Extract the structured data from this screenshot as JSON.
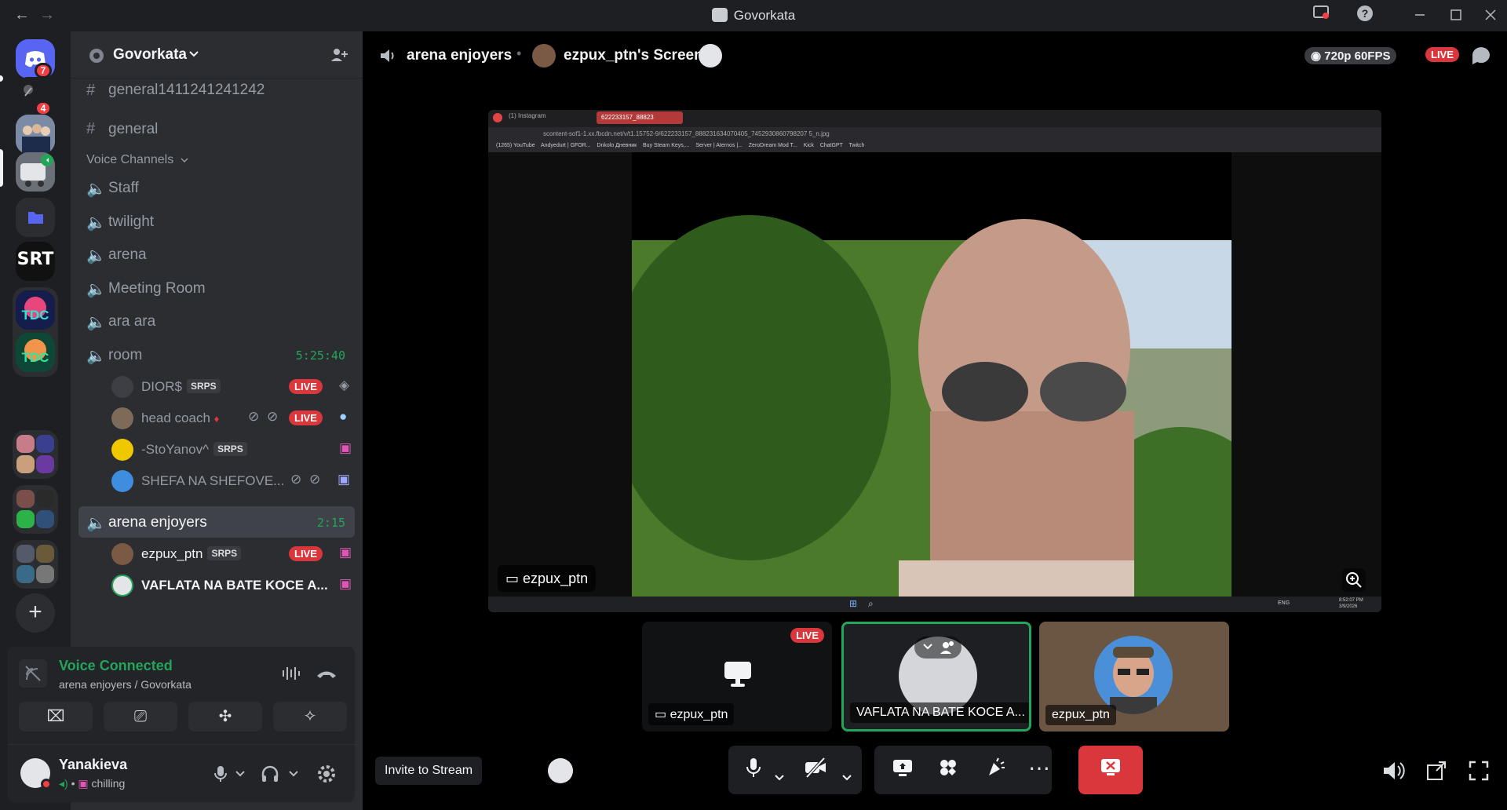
{
  "window": {
    "title": "Govorkata",
    "back_glyph": "←",
    "forward_glyph": "→",
    "icons": [
      "inbox-icon",
      "help-icon",
      "minimize-icon",
      "maximize-icon",
      "close-icon"
    ]
  },
  "rail": {
    "home_badge": "7",
    "dm_badge": "4",
    "server_glyphs": {
      "srt": "SRT",
      "tdc1": "TDC",
      "tdc2": "TDC",
      "add": "+"
    }
  },
  "server": {
    "name": "Govorkata",
    "text_channels": [
      {
        "name": "general1411241241242"
      },
      {
        "name": "general"
      }
    ],
    "voice_category": "Voice Channels",
    "voice_channels": [
      {
        "name": "Staff"
      },
      {
        "name": "twilight"
      },
      {
        "name": "arena"
      },
      {
        "name": "Meeting Room"
      },
      {
        "name": "ara ara"
      },
      {
        "name": "room",
        "timer": "5:25:40"
      },
      {
        "name": "arena enjoyers",
        "timer": "2:15"
      }
    ],
    "room_members": [
      {
        "name": "DIOR$",
        "tag": "SRPS",
        "live": "LIVE"
      },
      {
        "name": "head coach",
        "live": "LIVE"
      },
      {
        "name": "-StoYanov^",
        "tag": "SRPS"
      },
      {
        "name": "SHEFA NA SHEFOVE..."
      }
    ],
    "arena_members": [
      {
        "name": "ezpux_ptn",
        "tag": "SRPS",
        "live": "LIVE"
      },
      {
        "name": "VAFLATA NA BATE KOCE A..."
      }
    ]
  },
  "voice_panel": {
    "status": "Voice Connected",
    "location": "arena enjoyers / Govorkata"
  },
  "user": {
    "name": "Yanakieva",
    "status": "chilling"
  },
  "stage": {
    "channel": "arena enjoyers",
    "stream_title": "ezpux_ptn's Screen",
    "quality": "720p 60FPS",
    "live_label": "LIVE",
    "main_caption": "ezpux_ptn",
    "browser_tabs": [
      "(1) Instagram",
      "622233157_88823"
    ],
    "browser_url": "scontent-sof1-1.xx.fbcdn.net/v/t1.15752-9/622233157_888231634070405_7452930860798207 5_n.jpg",
    "bookmarks": [
      "(1265) YouTube",
      "Andyedurt | GFOR...",
      "Dnkolo Дневник",
      "Buy Steam Keys,...",
      "Server | Aternos |...",
      "ZeroDream Mod T...",
      "Kick",
      "ChatGPT",
      "Twitch"
    ],
    "taskbar_time": "8:52:07 PM",
    "taskbar_date": "3/9/2026",
    "taskbar_lang": "ENG",
    "tiles": [
      {
        "caption": "ezpux_ptn",
        "live": "LIVE"
      },
      {
        "caption": "VAFLATA NA BATE KOCE A..."
      },
      {
        "caption": "ezpux_ptn"
      }
    ],
    "invite_label": "Invite to Stream"
  },
  "colors": {
    "accent_green": "#23a55a",
    "live_red": "#da373c",
    "end_call_red": "#da373c",
    "speaking_border": "#23a55a"
  }
}
